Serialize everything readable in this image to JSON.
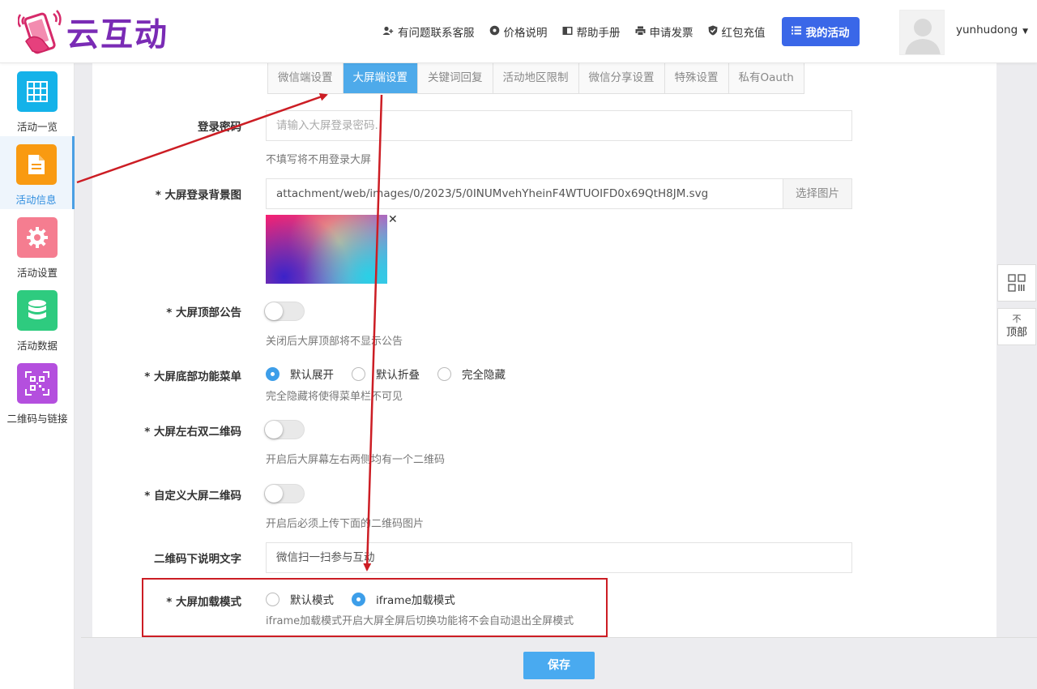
{
  "header": {
    "logo_text": "云互动",
    "nav": [
      {
        "label": "有问题联系客服",
        "icon": "user-plus-icon"
      },
      {
        "label": "价格说明",
        "icon": "gear-icon"
      },
      {
        "label": "帮助手册",
        "icon": "book-icon"
      },
      {
        "label": "申请发票",
        "icon": "printer-icon"
      },
      {
        "label": "红包充值",
        "icon": "shield-check-icon"
      }
    ],
    "my_activity": "我的活动",
    "username": "yunhudong"
  },
  "sidebar": {
    "items": [
      {
        "label": "活动一览",
        "icon": "grid-icon",
        "color": "#14b2e9"
      },
      {
        "label": "活动信息",
        "icon": "document-icon",
        "color": "#f99a11"
      },
      {
        "label": "活动设置",
        "icon": "gear-icon",
        "color": "#f57d90"
      },
      {
        "label": "活动数据",
        "icon": "database-icon",
        "color": "#2ecb7f"
      },
      {
        "label": "二维码与链接",
        "icon": "qrcode-icon",
        "color": "#b44fde"
      }
    ]
  },
  "tabs": [
    "微信端设置",
    "大屏端设置",
    "关键词回复",
    "活动地区限制",
    "微信分享设置",
    "特殊设置",
    "私有Oauth"
  ],
  "form": {
    "login_password": {
      "label": "登录密码",
      "placeholder": "请输入大屏登录密码.",
      "help": "不填写将不用登录大屏"
    },
    "login_bg": {
      "label": "* 大屏登录背景图",
      "value": "attachment/web/images/0/2023/5/0INUMvehYheinF4WTUOIFD0x69QtH8JM.svg",
      "button": "选择图片",
      "close": "✕"
    },
    "top_notice": {
      "label": "* 大屏顶部公告",
      "help": "关闭后大屏顶部将不显示公告"
    },
    "bottom_menu": {
      "label": "* 大屏底部功能菜单",
      "options": [
        "默认展开",
        "默认折叠",
        "完全隐藏"
      ],
      "selected": "默认展开",
      "help": "完全隐藏将使得菜单栏不可见"
    },
    "dual_qrcode": {
      "label": "* 大屏左右双二维码",
      "help": "开启后大屏幕左右两侧均有一个二维码"
    },
    "custom_qrcode": {
      "label": "* 自定义大屏二维码",
      "help": "开启后必须上传下面的二维码图片"
    },
    "qrcode_caption": {
      "label": "二维码下说明文字",
      "value": "微信扫一扫参与互动"
    },
    "load_mode": {
      "label": "* 大屏加载模式",
      "options": [
        "默认模式",
        "iframe加载模式"
      ],
      "selected": "iframe加载模式",
      "help": "iframe加载模式开启大屏全屏后切换功能将不会自动退出全屏模式"
    }
  },
  "footer": {
    "save": "保存"
  },
  "float_tools": {
    "top_label": "顶部",
    "top_arrow": "不"
  },
  "colors": {
    "primary": "#3a67e8",
    "tab_active": "#4eaaea",
    "annotation": "#cc1d24"
  }
}
